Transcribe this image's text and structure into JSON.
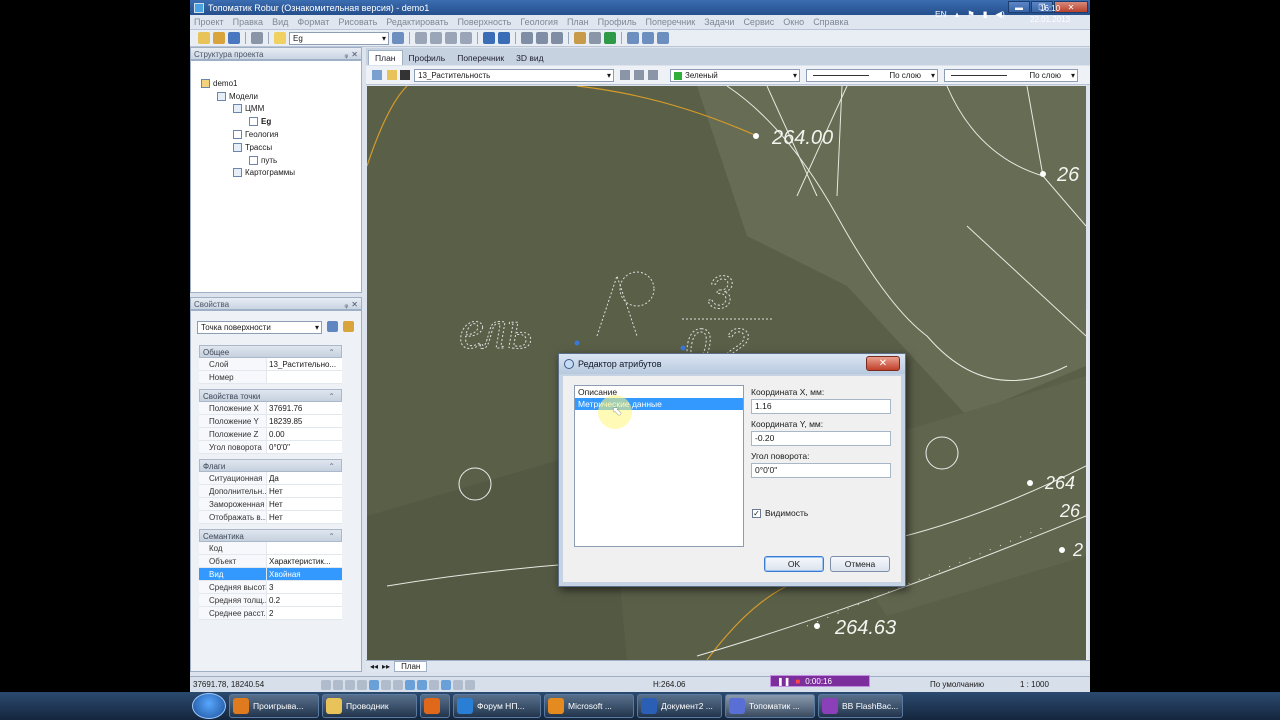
{
  "window": {
    "title": "Топоматик Robur (Ознакомительная версия) - demo1",
    "min": "▬",
    "max": "❐",
    "close": "✕"
  },
  "menu": [
    "Проект",
    "Правка",
    "Вид",
    "Формат",
    "Рисовать",
    "Редактировать",
    "Поверхность",
    "Геология",
    "План",
    "Профиль",
    "Поперечник",
    "Задачи",
    "Сервис",
    "Окно",
    "Справка"
  ],
  "toolbar": {
    "surface_combo": "Eg"
  },
  "project_panel": {
    "title": "Структура проекта",
    "tree": {
      "root": "demo1",
      "models": "Модели",
      "dtm": "ЦММ",
      "dtm_child": "Eg",
      "geology": "Геология",
      "routes": "Трассы",
      "route_child": "путь",
      "cartograms": "Картограммы"
    }
  },
  "props_panel": {
    "title": "Свойства",
    "type_combo": "Точка поверхности",
    "sections": {
      "general": "Общее",
      "point": "Свойства точки",
      "flags": "Флаги",
      "semantics": "Семантика"
    },
    "general_rows": [
      {
        "k": "Слой",
        "v": "13_Растительно..."
      },
      {
        "k": "Номер",
        "v": ""
      }
    ],
    "point_rows": [
      {
        "k": "Положение X",
        "v": "37691.76"
      },
      {
        "k": "Положение Y",
        "v": "18239.85"
      },
      {
        "k": "Положение Z",
        "v": "0.00"
      },
      {
        "k": "Угол поворота",
        "v": "0°0'0\""
      }
    ],
    "flag_rows": [
      {
        "k": "Ситуационная",
        "v": "Да"
      },
      {
        "k": "Дополнительн...",
        "v": "Нет"
      },
      {
        "k": "Замороженная",
        "v": "Нет"
      },
      {
        "k": "Отображать в...",
        "v": "Нет"
      }
    ],
    "sem_rows": [
      {
        "k": "Код",
        "v": ""
      },
      {
        "k": "Объект",
        "v": "Характеристик..."
      },
      {
        "k": "Вид",
        "v": "Хвойная"
      },
      {
        "k": "Средняя высота",
        "v": "3"
      },
      {
        "k": "Средняя толщ...",
        "v": "0.2"
      },
      {
        "k": "Среднее расст...",
        "v": "2"
      }
    ]
  },
  "doc_tabs": [
    "План",
    "Профиль",
    "Поперечник",
    "3D вид"
  ],
  "layer_bar": {
    "layer": "13_Растительность",
    "color": "Зеленый",
    "line1": "По слою",
    "line2": "По слою",
    "green": "#2fae3a"
  },
  "canvas": {
    "labels": [
      "264.00",
      "264.63",
      "26",
      "264",
      "26",
      "2"
    ],
    "hatch_text": "ель",
    "fraction_top": "3",
    "fraction_bottom": "0.2",
    "bg": "#5a5f48"
  },
  "bottom_tab": "План",
  "status": {
    "coords": "37691.78, 18240.54",
    "height": "H:264.06",
    "view": "По умолчанию",
    "scale": "1 : 1000"
  },
  "recorder": {
    "time": "0:00:16"
  },
  "dialog": {
    "title": "Редактор атрибутов",
    "close": "✕",
    "items": [
      "Описание",
      "Метрические данные"
    ],
    "x_label": "Координата X, мм:",
    "x_value": "1.16",
    "y_label": "Координата Y, мм:",
    "y_value": "-0.20",
    "angle_label": "Угол поворота:",
    "angle_value": "0°0'0\"",
    "visible_label": "Видимость",
    "ok": "OK",
    "cancel": "Отмена"
  },
  "taskbar": {
    "items": [
      {
        "label": "Проигрыва...",
        "color": "#e07a1f"
      },
      {
        "label": "Проводник",
        "color": "#e8c35a"
      },
      {
        "label": "",
        "color": "#e0681a"
      },
      {
        "label": "Форум НП...",
        "color": "#2a7fd4"
      },
      {
        "label": "Microsoft ...",
        "color": "#e58a1e"
      },
      {
        "label": "Документ2 ...",
        "color": "#2b5fb5"
      },
      {
        "label": "Топоматик ...",
        "color": "#5a6fd6"
      },
      {
        "label": "BB FlashBac...",
        "color": "#8b3fb8"
      }
    ],
    "lang": "EN",
    "time": "16:10",
    "date": "22.01.2013"
  }
}
